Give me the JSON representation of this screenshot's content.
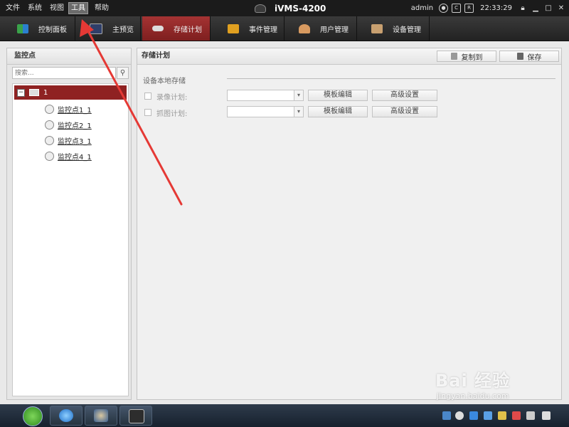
{
  "menubar": {
    "items": [
      "文件",
      "系统",
      "视图",
      "工具",
      "帮助"
    ],
    "active_item": "工具",
    "app_title": "iVMS-4200",
    "user": "admin",
    "clock": "22:33:29"
  },
  "tabs": [
    {
      "label": "控制面板",
      "icon": "control-panel-icon",
      "active": false
    },
    {
      "label": "主预览",
      "icon": "main-preview-icon",
      "active": false
    },
    {
      "label": "存储计划",
      "icon": "storage-schedule-icon",
      "active": true
    },
    {
      "label": "事件管理",
      "icon": "event-management-icon",
      "active": false
    },
    {
      "label": "用户管理",
      "icon": "user-management-icon",
      "active": false
    },
    {
      "label": "设备管理",
      "icon": "device-management-icon",
      "active": false
    }
  ],
  "left_panel": {
    "title": "监控点",
    "search_placeholder": "搜索...",
    "tree_root_label": "1",
    "tree_items": [
      "监控点1_1",
      "监控点2_1",
      "监控点3_1",
      "监控点4_1"
    ]
  },
  "main_panel": {
    "title": "存储计划",
    "copy_to_label": "复制到",
    "save_label": "保存",
    "section_label": "设备本地存储",
    "rows": [
      {
        "label": "录像计划:",
        "template_edit": "模板编辑",
        "advanced": "高级设置",
        "checked": false
      },
      {
        "label": "抓图计划:",
        "template_edit": "模板编辑",
        "advanced": "高级设置",
        "checked": false
      }
    ]
  },
  "watermark": {
    "logo": "Bai 经验",
    "url": "jingyan.baidu.com"
  },
  "colors": {
    "active_tab": "#8f2525",
    "tree_selected": "#8f2222",
    "annotation_arrow": "#e53935"
  }
}
